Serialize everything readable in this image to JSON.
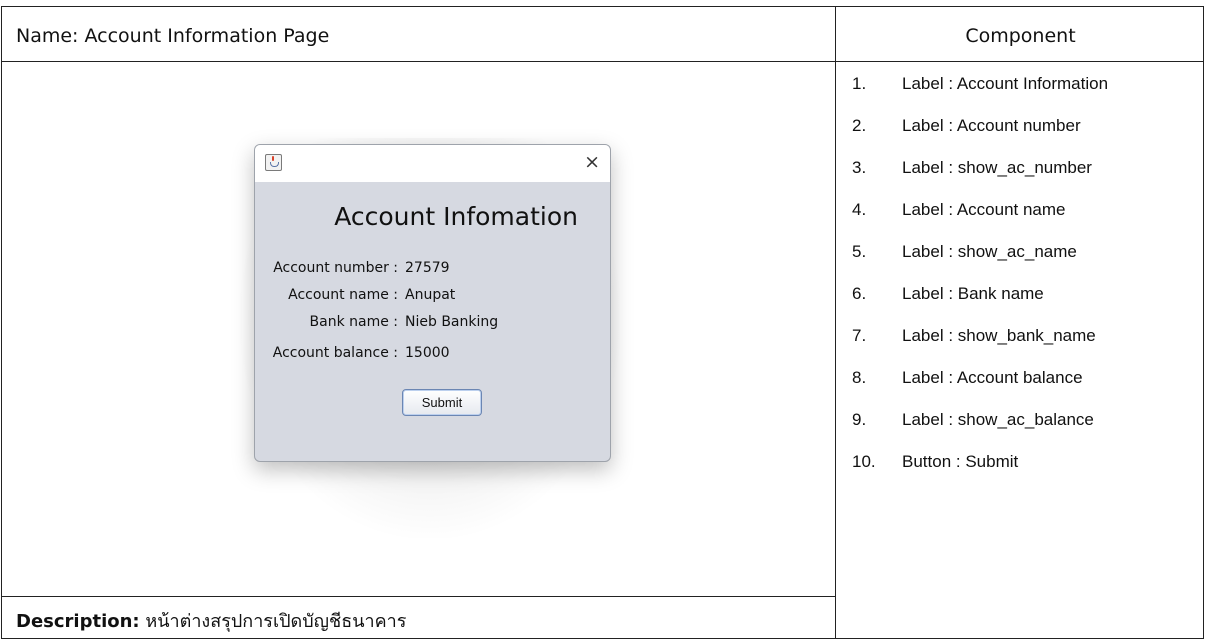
{
  "spec": {
    "name_heading": "Name: Account Information Page",
    "component_heading": "Component",
    "description_label": "Description:",
    "description_text": "หน้าต่างสรุปการเปิดบัญชีธนาคาร"
  },
  "components": [
    {
      "num": "1.",
      "text": "Label : Account Information"
    },
    {
      "num": "2.",
      "text": "Label : Account number"
    },
    {
      "num": "3.",
      "text": "Label : show_ac_number"
    },
    {
      "num": "4.",
      "text": "Label : Account name"
    },
    {
      "num": "5.",
      "text": "Label : show_ac_name"
    },
    {
      "num": "6.",
      "text": "Label : Bank name"
    },
    {
      "num": "7.",
      "text": "Label : show_bank_name"
    },
    {
      "num": "8.",
      "text": "Label : Account balance"
    },
    {
      "num": "9.",
      "text": "Label : show_ac_balance"
    },
    {
      "num": "10.",
      "text": "Button : Submit"
    }
  ],
  "window": {
    "title": "Account Infomation",
    "close_glyph": "×",
    "fields": [
      {
        "label": "Account number :",
        "value": "27579"
      },
      {
        "label": "Account name :",
        "value": "Anupat"
      },
      {
        "label": "Bank name :",
        "value": "Nieb Banking"
      },
      {
        "label": "Account balance :",
        "value": "15000"
      }
    ],
    "submit_label": "Submit"
  },
  "icons": {
    "window_icon": "java-icon",
    "close": "close-icon"
  },
  "colors": {
    "window_background": "#d6d9e1",
    "titlebar_background": "#ffffff",
    "table_border": "#222222"
  }
}
